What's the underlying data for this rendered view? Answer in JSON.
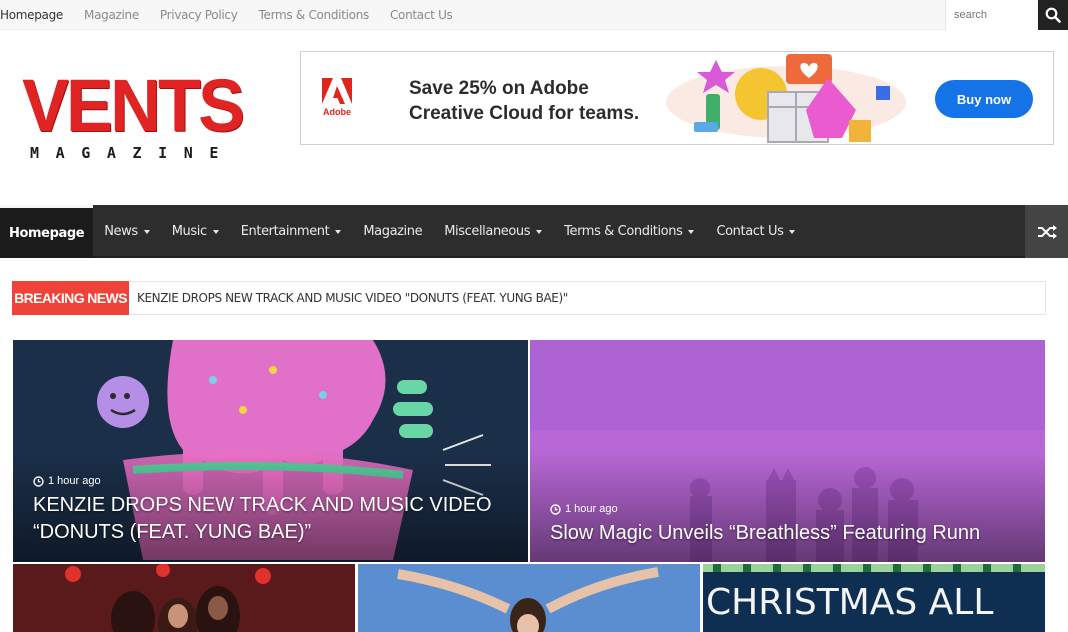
{
  "top_nav": {
    "links": [
      "Homepage",
      "Magazine",
      "Privacy Policy",
      "Terms & Conditions",
      "Contact Us"
    ],
    "search_placeholder": "search"
  },
  "logo": {
    "main": "VENTS",
    "sub": "MAGAZINE"
  },
  "ad": {
    "brand": "Adobe",
    "headline_line1": "Save 25% on Adobe",
    "headline_line2": "Creative Cloud for teams.",
    "button": "Buy now"
  },
  "main_nav": {
    "items": [
      {
        "label": "Homepage",
        "dropdown": false
      },
      {
        "label": "News",
        "dropdown": true
      },
      {
        "label": "Music",
        "dropdown": true
      },
      {
        "label": "Entertainment",
        "dropdown": true
      },
      {
        "label": "Magazine",
        "dropdown": false
      },
      {
        "label": "Miscellaneous",
        "dropdown": true
      },
      {
        "label": "Terms & Conditions",
        "dropdown": true
      },
      {
        "label": "Contact Us",
        "dropdown": true
      }
    ]
  },
  "breaking": {
    "label": "BREAKING NEWS",
    "headline": "KENZIE DROPS NEW TRACK AND MUSIC VIDEO \"DONUTS (FEAT. YUNG BAE)\""
  },
  "featured": [
    {
      "time": "1 hour ago",
      "title_line1": "KENZIE DROPS NEW TRACK AND MUSIC VIDEO",
      "title_line2": "“DONUTS (FEAT. YUNG BAE)”"
    },
    {
      "time": "1 hour ago",
      "title": "Slow Magic Unveils “Breathless” Featuring Runn"
    }
  ],
  "thumbs": [
    {
      "image_text": ""
    },
    {
      "image_text": ""
    },
    {
      "image_text": "CHRISTMAS ALL"
    }
  ],
  "colors": {
    "accent_red": "#e02323",
    "breaking_red": "#ef4339",
    "nav_dark": "#2d2d2d",
    "ad_button": "#1473e6"
  }
}
